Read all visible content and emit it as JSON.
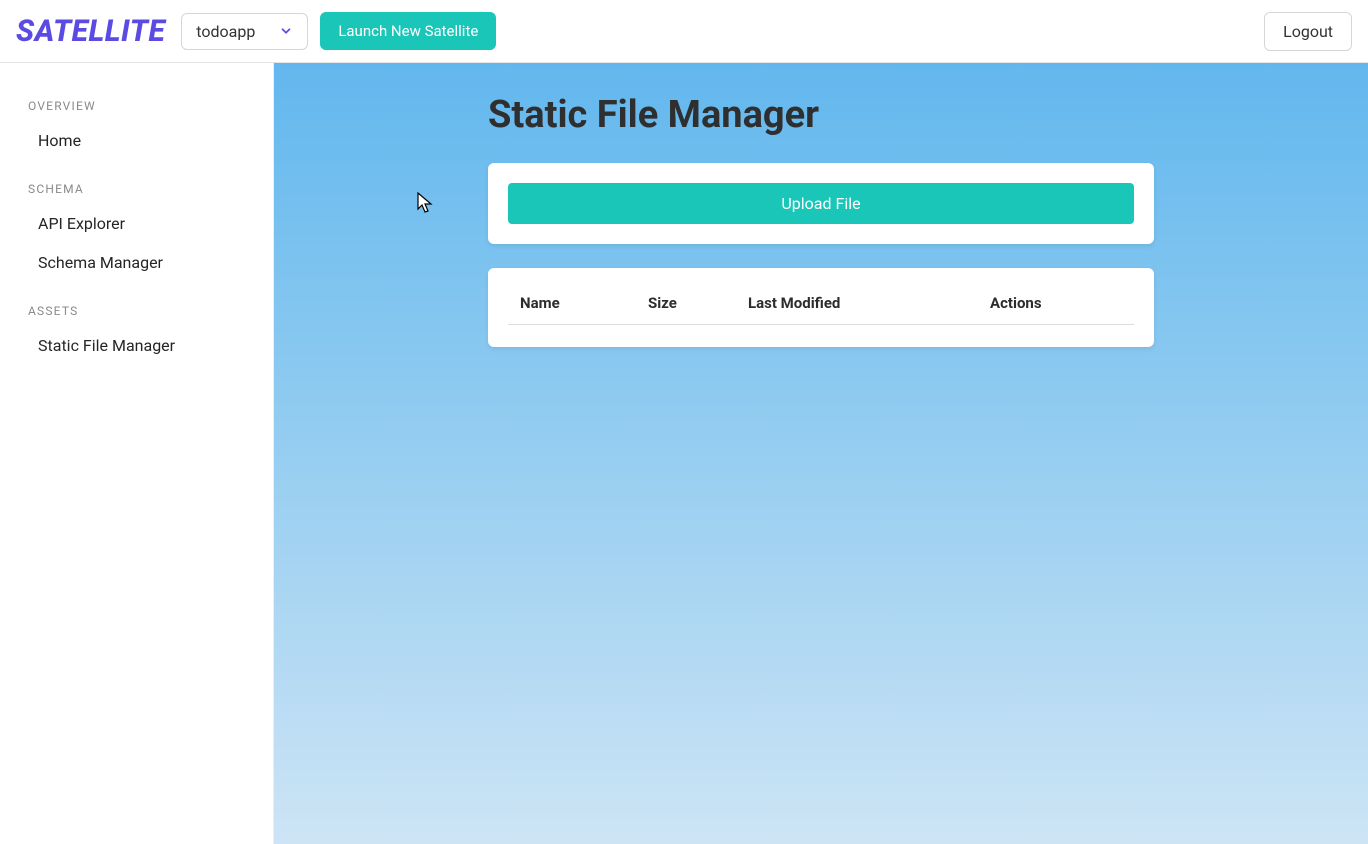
{
  "header": {
    "logo": "SATELLITE",
    "project_selected": "todoapp",
    "launch_label": "Launch New Satellite",
    "logout_label": "Logout"
  },
  "sidebar": {
    "groups": [
      {
        "label": "OVERVIEW",
        "items": [
          {
            "label": "Home"
          }
        ]
      },
      {
        "label": "SCHEMA",
        "items": [
          {
            "label": "API Explorer"
          },
          {
            "label": "Schema Manager"
          }
        ]
      },
      {
        "label": "ASSETS",
        "items": [
          {
            "label": "Static File Manager"
          }
        ]
      }
    ]
  },
  "main": {
    "title": "Static File Manager",
    "upload_label": "Upload File",
    "table": {
      "columns": {
        "name": "Name",
        "size": "Size",
        "modified": "Last Modified",
        "actions": "Actions"
      },
      "rows": []
    }
  },
  "colors": {
    "brand": "#5b4be3",
    "accent": "#19c6b8"
  }
}
